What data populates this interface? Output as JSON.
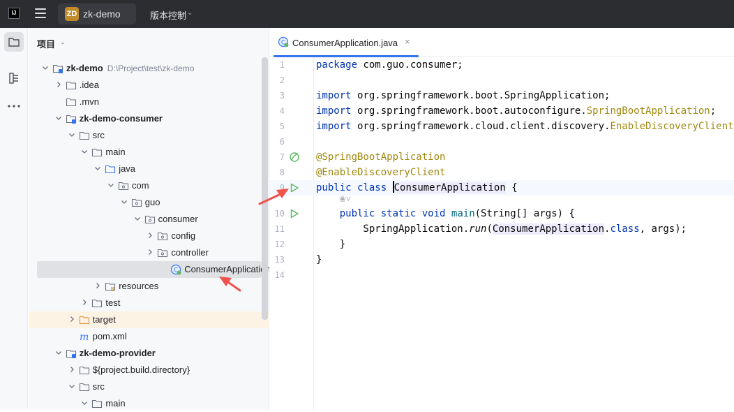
{
  "titlebar": {
    "logo_text": "IJ",
    "project_badge": "ZD",
    "project_name": "zk-demo",
    "vcs_label": "版本控制"
  },
  "panel": {
    "title": "项目"
  },
  "tree": [
    {
      "label": "zk-demo",
      "path": "D:\\Project\\test\\zk-demo",
      "bold": true,
      "indent": 0,
      "chev": "down",
      "icon": "module-folder"
    },
    {
      "label": ".idea",
      "indent": 1,
      "chev": "right",
      "icon": "folder"
    },
    {
      "label": ".mvn",
      "indent": 1,
      "chev": "none",
      "icon": "folder"
    },
    {
      "label": "zk-demo-consumer",
      "bold": true,
      "indent": 1,
      "chev": "down",
      "icon": "module-folder"
    },
    {
      "label": "src",
      "indent": 2,
      "chev": "down",
      "icon": "folder"
    },
    {
      "label": "main",
      "indent": 3,
      "chev": "down",
      "icon": "folder"
    },
    {
      "label": "java",
      "indent": 4,
      "chev": "down",
      "icon": "source-folder"
    },
    {
      "label": "com",
      "indent": 5,
      "chev": "down",
      "icon": "package"
    },
    {
      "label": "guo",
      "indent": 6,
      "chev": "down",
      "icon": "package"
    },
    {
      "label": "consumer",
      "indent": 7,
      "chev": "down",
      "icon": "package"
    },
    {
      "label": "config",
      "indent": 8,
      "chev": "right",
      "icon": "package"
    },
    {
      "label": "controller",
      "indent": 8,
      "chev": "right",
      "icon": "package"
    },
    {
      "label": "ConsumerApplication",
      "indent": 9,
      "chev": "none",
      "icon": "spring-class",
      "selected": true
    },
    {
      "label": "resources",
      "indent": 4,
      "chev": "right",
      "icon": "resources-folder"
    },
    {
      "label": "test",
      "indent": 3,
      "chev": "right",
      "icon": "folder"
    },
    {
      "label": "target",
      "indent": 2,
      "chev": "right",
      "icon": "excluded-folder",
      "excluded": true
    },
    {
      "label": "pom.xml",
      "indent": 2,
      "chev": "none",
      "icon": "maven"
    },
    {
      "label": "zk-demo-provider",
      "bold": true,
      "indent": 1,
      "chev": "down",
      "icon": "module-folder"
    },
    {
      "label": "${project.build.directory}",
      "indent": 2,
      "chev": "right",
      "icon": "folder"
    },
    {
      "label": "src",
      "indent": 2,
      "chev": "down",
      "icon": "folder"
    },
    {
      "label": "main",
      "indent": 3,
      "chev": "down",
      "icon": "folder"
    }
  ],
  "editor": {
    "tab_label": "ConsumerApplication.java",
    "tab_close": "×",
    "inlay_hint": "❀˅",
    "lines": [
      {
        "n": "1",
        "tokens": [
          {
            "t": "package",
            "c": "kw"
          },
          {
            "t": " com.guo.consumer;"
          }
        ]
      },
      {
        "n": "2",
        "tokens": []
      },
      {
        "n": "3",
        "tokens": [
          {
            "t": "import",
            "c": "kw"
          },
          {
            "t": " org.springframework.boot.SpringApplication;"
          }
        ]
      },
      {
        "n": "4",
        "tokens": [
          {
            "t": "import",
            "c": "kw"
          },
          {
            "t": " org.springframework.boot.autoconfigure."
          },
          {
            "t": "SpringBootApplication",
            "c": "cls"
          },
          {
            "t": ";"
          }
        ]
      },
      {
        "n": "5",
        "tokens": [
          {
            "t": "import",
            "c": "kw"
          },
          {
            "t": " org.springframework.cloud.client.discovery."
          },
          {
            "t": "EnableDiscoveryClient",
            "c": "cls"
          },
          {
            "t": ";"
          }
        ]
      },
      {
        "n": "6",
        "tokens": []
      },
      {
        "n": "7",
        "tokens": [
          {
            "t": "@SpringBootApplication",
            "c": "ann"
          }
        ]
      },
      {
        "n": "8",
        "tokens": [
          {
            "t": "@EnableDiscoveryClient",
            "c": "ann"
          }
        ]
      },
      {
        "n": "9",
        "tokens": [
          {
            "t": "public",
            "c": "kw"
          },
          {
            "t": " "
          },
          {
            "t": "class",
            "c": "kw"
          },
          {
            "t": " "
          },
          {
            "t": "",
            "c": "caret"
          },
          {
            "t": "ConsumerApplication",
            "c": "hl"
          },
          {
            "t": " {"
          }
        ]
      },
      {
        "n": "10",
        "tokens": [
          {
            "t": "    "
          },
          {
            "t": "public",
            "c": "kw"
          },
          {
            "t": " "
          },
          {
            "t": "static",
            "c": "kw"
          },
          {
            "t": " "
          },
          {
            "t": "void",
            "c": "kw"
          },
          {
            "t": " "
          },
          {
            "t": "main",
            "c": "fn"
          },
          {
            "t": "(String[] args) {"
          }
        ]
      },
      {
        "n": "11",
        "tokens": [
          {
            "t": "        SpringApplication."
          },
          {
            "t": "run",
            "c": "ital"
          },
          {
            "t": "("
          },
          {
            "t": "ConsumerApplication",
            "c": "hl"
          },
          {
            "t": "."
          },
          {
            "t": "class",
            "c": "kw"
          },
          {
            "t": ", args);"
          }
        ]
      },
      {
        "n": "12",
        "tokens": [
          {
            "t": "    }"
          }
        ]
      },
      {
        "n": "13",
        "tokens": [
          {
            "t": "}"
          }
        ]
      },
      {
        "n": "14",
        "tokens": []
      }
    ]
  },
  "colors": {
    "accent": "#3574f0",
    "run_green": "#5fb865",
    "annotation_arrow": "#f0524c"
  }
}
